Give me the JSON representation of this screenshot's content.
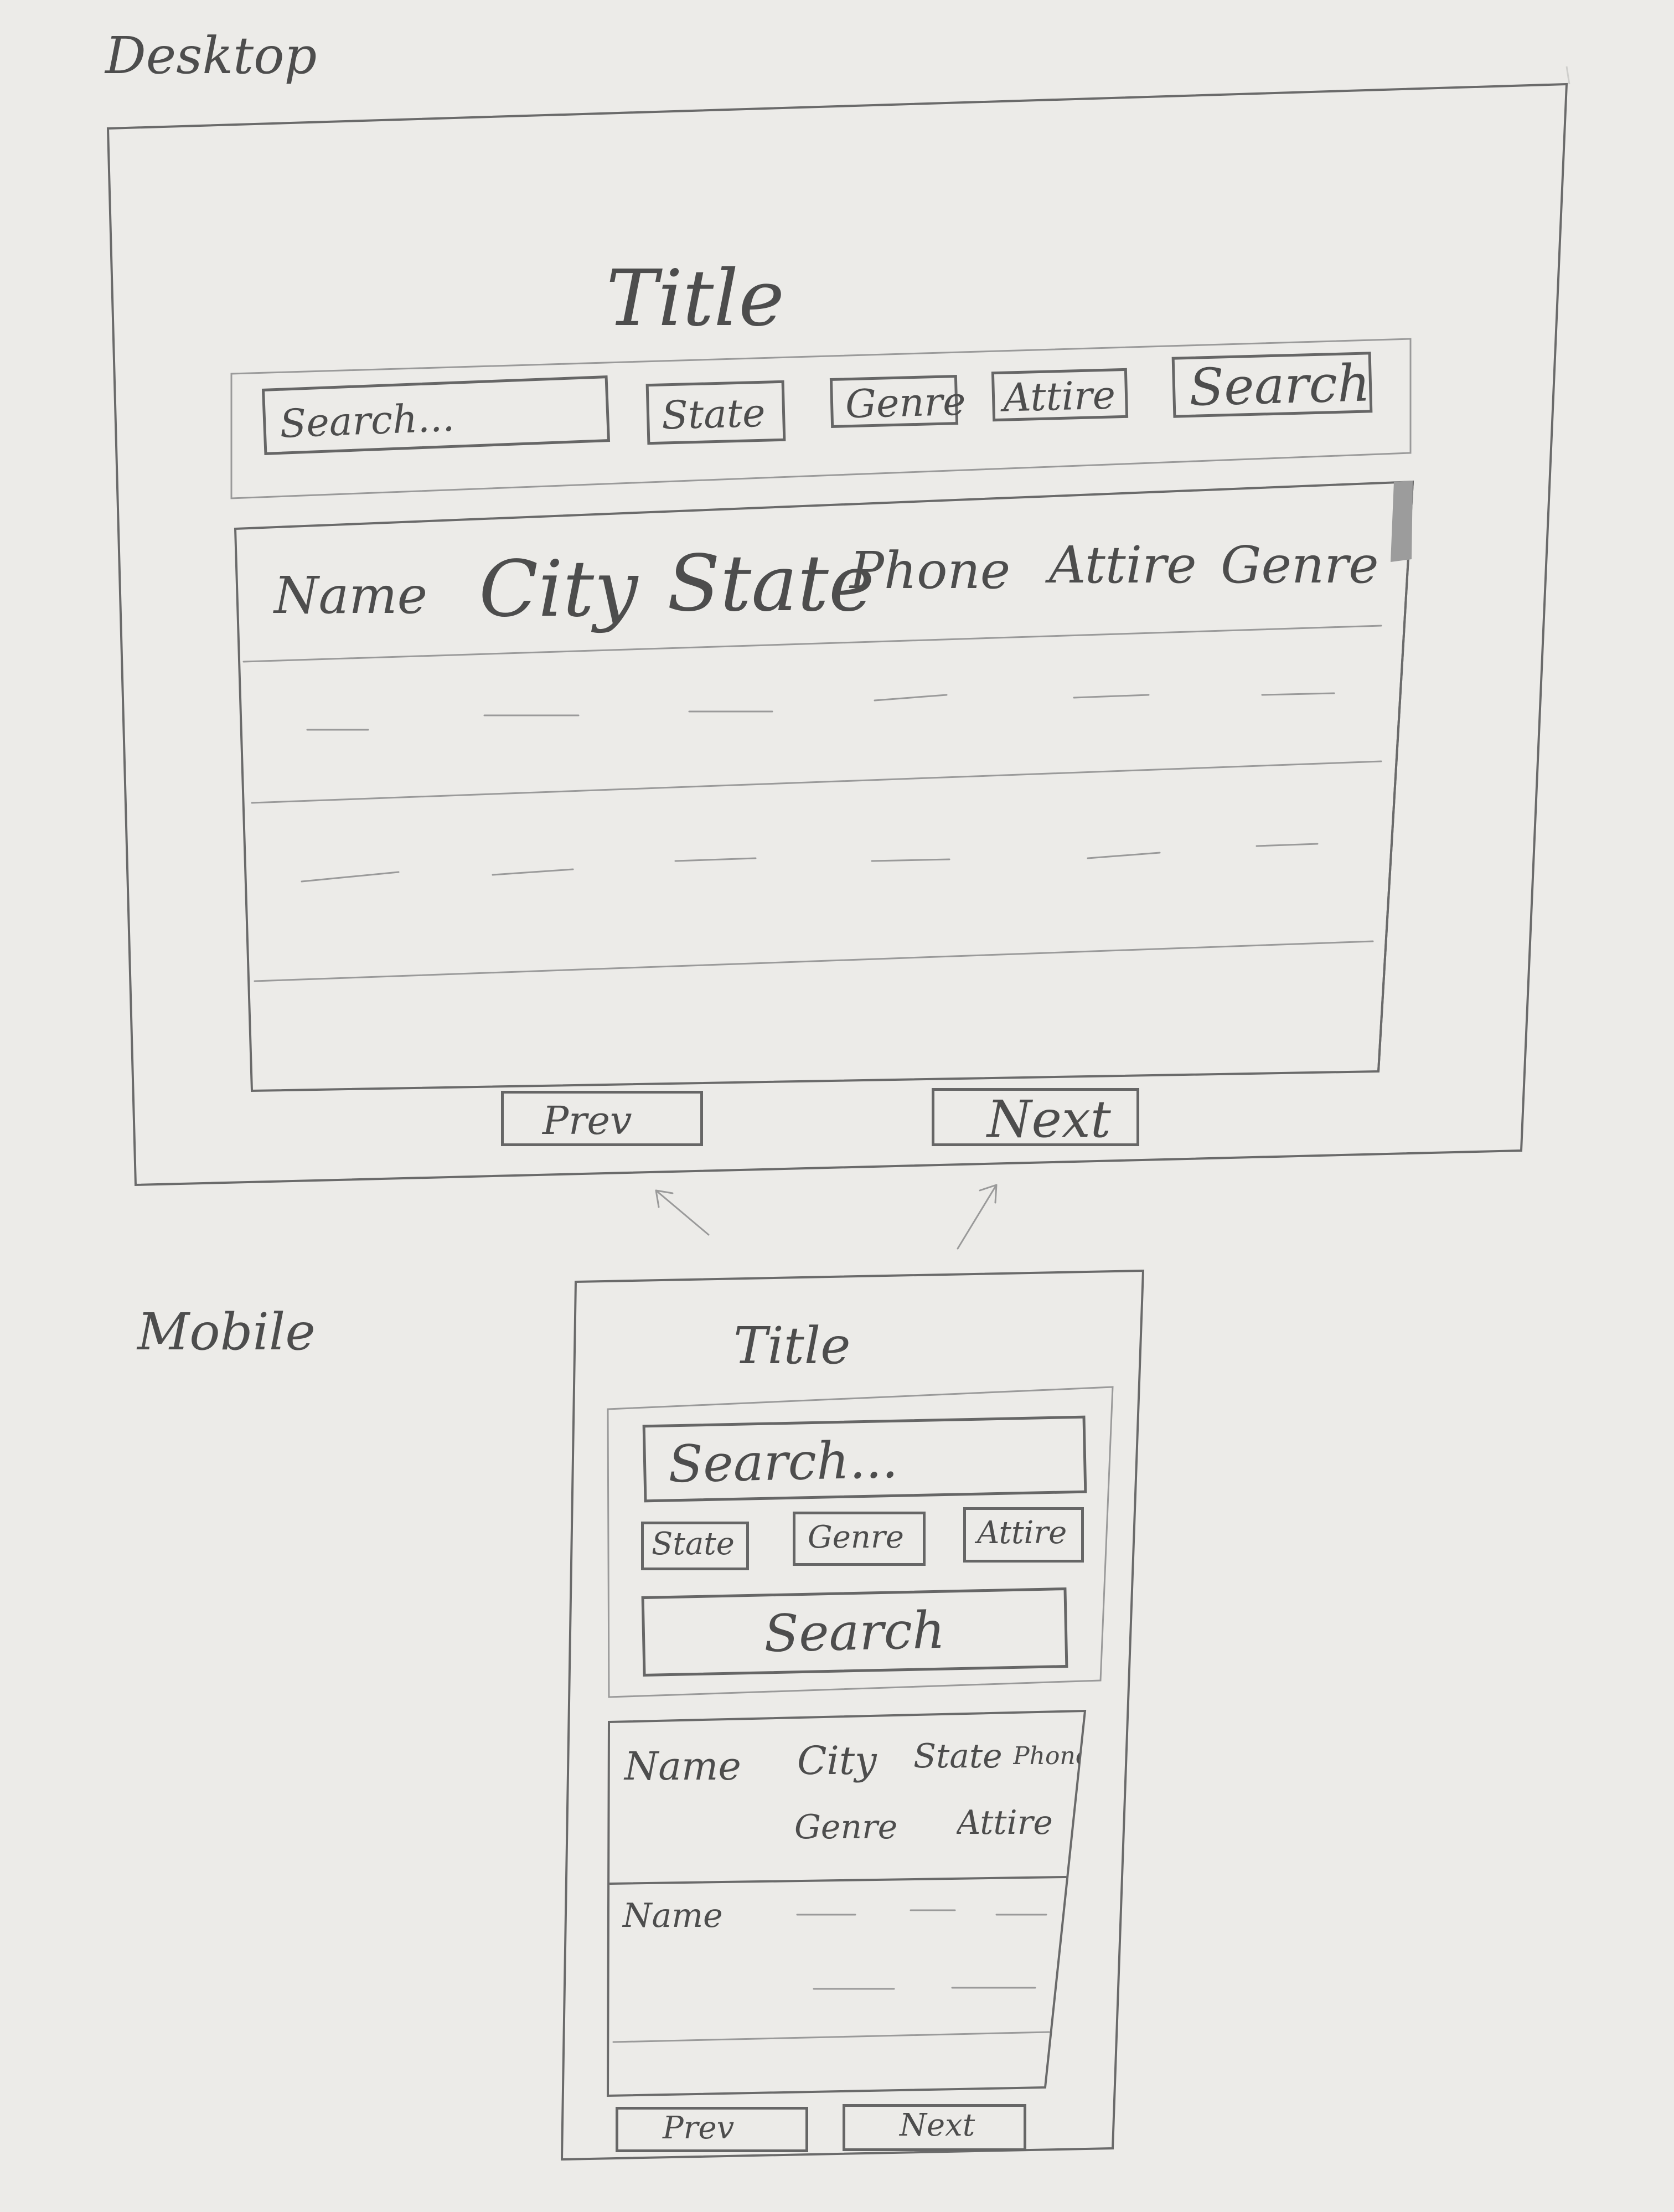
{
  "labels": {
    "desktop": "Desktop",
    "mobile": "Mobile"
  },
  "desktop": {
    "title": "Title",
    "search_placeholder": "Search...",
    "filters": [
      "State",
      "Genre",
      "Attire"
    ],
    "search_button": "Search",
    "columns": [
      "Name",
      "City",
      "State",
      "Phone",
      "Attire",
      "Genre"
    ],
    "prev": "Prev",
    "next": "Next"
  },
  "mobile": {
    "title": "Title",
    "search_placeholder": "Search...",
    "filters": [
      "State",
      "Genre",
      "Attire"
    ],
    "search_button": "Search",
    "header_row1": [
      "Name",
      "City",
      "State",
      "Phone"
    ],
    "header_row2": [
      "Genre",
      "Attire"
    ],
    "row_label": "Name",
    "prev": "Prev",
    "next": "Next"
  }
}
